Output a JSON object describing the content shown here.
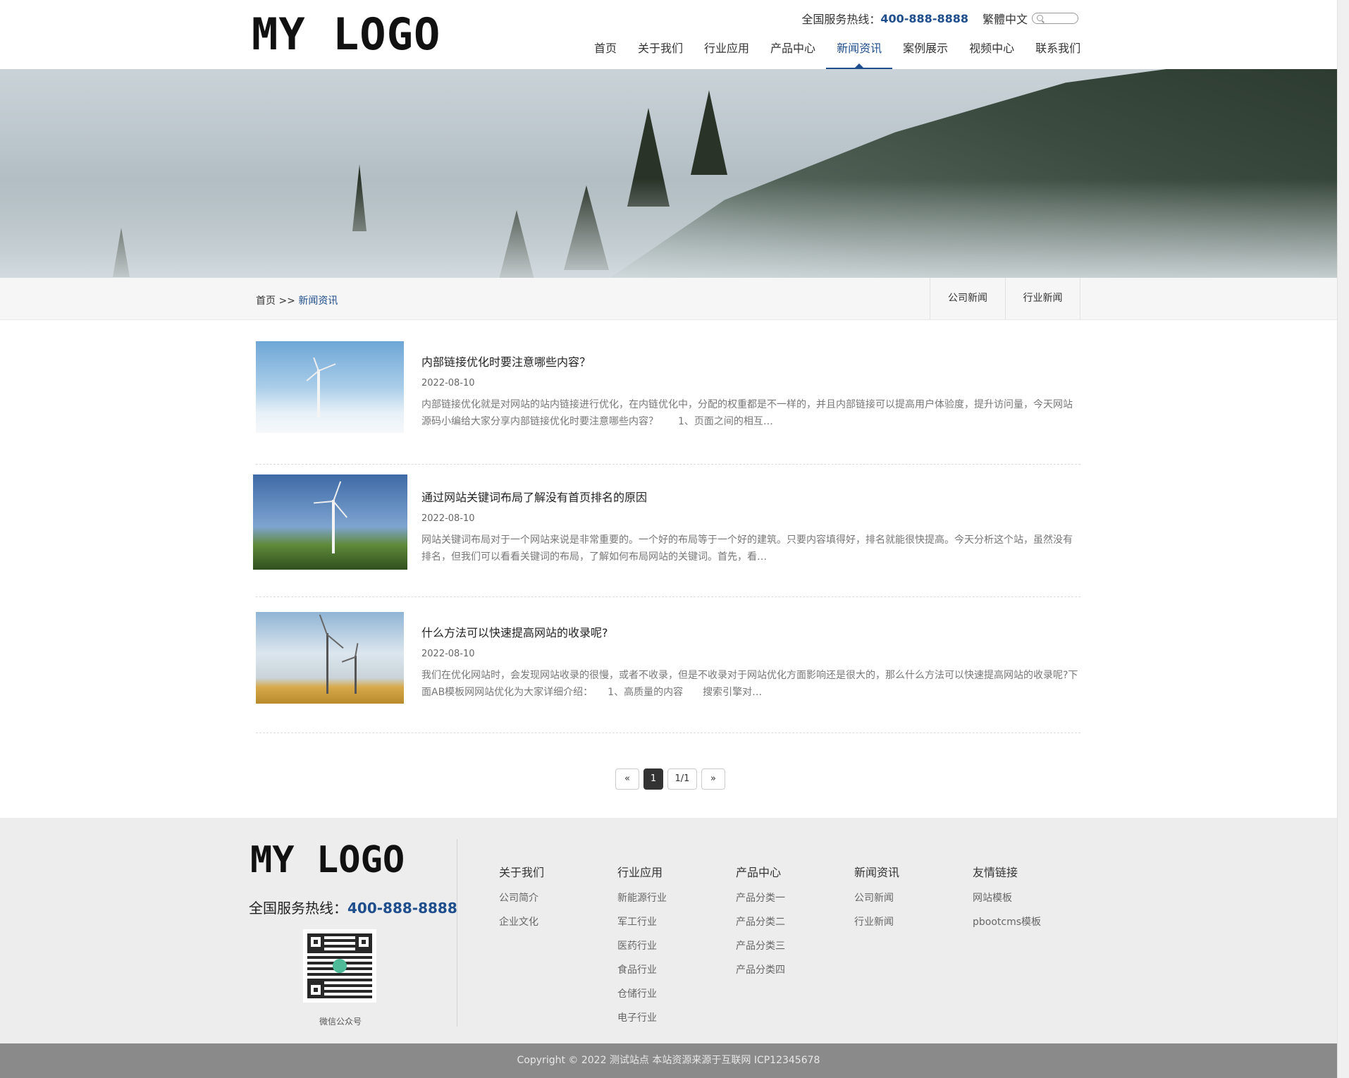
{
  "header": {
    "logo_text": "MY LOGO",
    "hotline_label": "全国服务热线：",
    "hotline_number": "400-888-8888",
    "lang_switch": "繁體中文",
    "nav": [
      {
        "label": "首页"
      },
      {
        "label": "关于我们"
      },
      {
        "label": "行业应用"
      },
      {
        "label": "产品中心"
      },
      {
        "label": "新闻资讯",
        "active": true
      },
      {
        "label": "案例展示"
      },
      {
        "label": "视频中心"
      },
      {
        "label": "联系我们"
      }
    ]
  },
  "breadcrumb": {
    "home": "首页",
    "separator": ">>",
    "current": "新闻资讯"
  },
  "subtabs": [
    "公司新闻",
    "行业新闻"
  ],
  "news": [
    {
      "title": "内部链接优化时要注意哪些内容？",
      "date": "2022-08-10",
      "desc": "内部链接优化就是对网站的站内链接进行优化，在内链优化中，分配的权重都是不一样的，并且内部链接可以提高用户体验度，提升访问量，今天网站源码小编给大家分享内部链接优化时要注意哪些内容？　　1、页面之间的相互…"
    },
    {
      "title": "通过网站关键词布局了解没有首页排名的原因",
      "date": "2022-08-10",
      "desc": "网站关键词布局对于一个网站来说是非常重要的。一个好的布局等于一个好的建筑。只要内容填得好，排名就能很快提高。今天分析这个站，虽然没有排名，但我们可以看看关键词的布局，了解如何布局网站的关键词。首先，看…"
    },
    {
      "title": "什么方法可以快速提高网站的收录呢?",
      "date": "2022-08-10",
      "desc": "我们在优化网站时，会发现网站收录的很慢，或者不收录，但是不收录对于网站优化方面影响还是很大的，那么什么方法可以快速提高网站的收录呢?下面AB模板网网站优化为大家详细介绍：　　1、高质量的内容　　搜索引擎对…"
    }
  ],
  "pagination": {
    "prev": "«",
    "current": "1",
    "info": "1/1",
    "next": "»"
  },
  "footer": {
    "logo_text": "MY LOGO",
    "hotline_label": "全国服务热线：",
    "hotline_number": "400-888-8888",
    "qr_label": "微信公众号",
    "columns": [
      {
        "title": "关于我们",
        "links": [
          "公司简介",
          "企业文化"
        ]
      },
      {
        "title": "行业应用",
        "links": [
          "新能源行业",
          "军工行业",
          "医药行业",
          "食品行业",
          "仓储行业",
          "电子行业"
        ]
      },
      {
        "title": "产品中心",
        "links": [
          "产品分类一",
          "产品分类二",
          "产品分类三",
          "产品分类四"
        ]
      },
      {
        "title": "新闻资讯",
        "links": [
          "公司新闻",
          "行业新闻"
        ]
      },
      {
        "title": "友情链接",
        "links": [
          "网站模板",
          "pbootcms模板"
        ]
      }
    ],
    "copyright": "Copyright © 2022 测试站点 本站资源来源于互联网  ICP12345678"
  },
  "colors": {
    "accent": "#1f4e8c",
    "footer_bg": "#ededed",
    "copyright_bg": "#8a8a8a"
  }
}
